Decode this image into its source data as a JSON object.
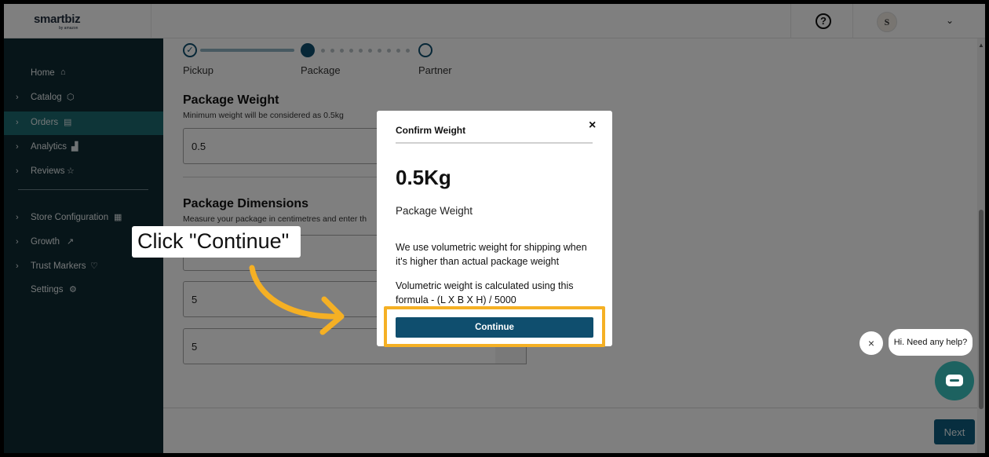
{
  "header": {
    "logo_text": "smartbiz",
    "logo_sub": "by amazon",
    "help_glyph": "?",
    "avatar_initial": "S",
    "chevron": "⌄"
  },
  "sidebar": {
    "items": [
      {
        "label": "Home",
        "icon": "home-icon",
        "glyph": "⌂"
      },
      {
        "label": "Catalog",
        "icon": "cube-icon",
        "glyph": "⬡"
      },
      {
        "label": "Orders",
        "icon": "clipboard-icon",
        "glyph": "▤"
      },
      {
        "label": "Analytics",
        "icon": "bar-chart-icon",
        "glyph": "▟"
      },
      {
        "label": "Reviews",
        "icon": "star-icon",
        "glyph": "☆"
      },
      {
        "label": "Store Configuration",
        "icon": "store-icon",
        "glyph": "▦"
      },
      {
        "label": "Growth",
        "icon": "trend-icon",
        "glyph": "↗"
      },
      {
        "label": "Trust Markers",
        "icon": "shield-heart-icon",
        "glyph": "♡"
      },
      {
        "label": "Settings",
        "icon": "gear-icon",
        "glyph": "⚙"
      }
    ],
    "active": "Orders",
    "chevron": "›"
  },
  "stepper": {
    "steps": [
      "Pickup",
      "Package",
      "Partner"
    ],
    "current": "Package"
  },
  "form": {
    "weight_title": "Package Weight",
    "weight_sub": "Minimum weight will be considered as 0.5kg",
    "weight_value": "0.5",
    "dims_title": "Package Dimensions",
    "dims_sub": "Measure your package in centimetres and enter th",
    "dim_values": [
      "",
      "5",
      "5"
    ]
  },
  "footer": {
    "next_label": "Next"
  },
  "modal": {
    "title": "Confirm Weight",
    "close_glyph": "×",
    "weight": "0.5Kg",
    "weight_label": "Package Weight",
    "para1": "We use volumetric weight for shipping when it's higher than actual package weight",
    "para2": "Volumetric weight is calculated using this formula - (L X B X H) / 5000",
    "continue_label": "Continue"
  },
  "callout": {
    "text": "Click \"Continue\""
  },
  "chat": {
    "bubble": "Hi. Need any help?",
    "close_glyph": "×"
  },
  "colors": {
    "sidebar": "#0f2b33",
    "active": "#1d6b71",
    "primary": "#0f4e6e",
    "highlight": "#f5b024",
    "chat": "#1d6260"
  }
}
